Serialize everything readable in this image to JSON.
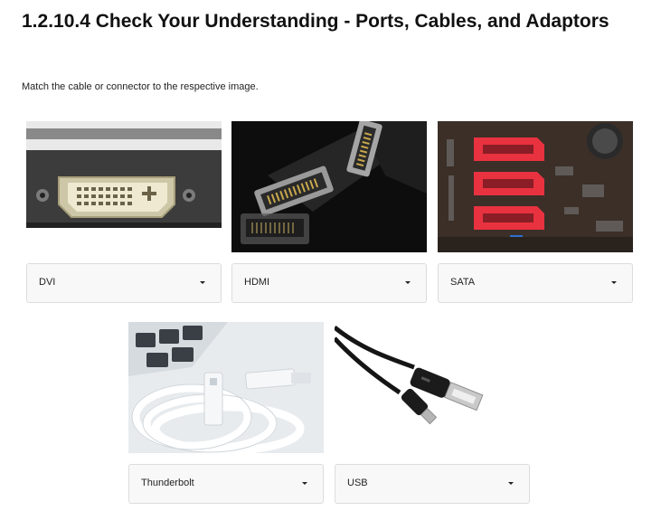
{
  "page": {
    "title": "1.2.10.4 Check Your Understanding - Ports, Cables, and Adaptors",
    "instructions": "Match the cable or connector to the respective image."
  },
  "items": [
    {
      "image": "dvi-port-photo",
      "selected": "DVI"
    },
    {
      "image": "hdmi-cable-photo",
      "selected": "HDMI"
    },
    {
      "image": "sata-ports-photo",
      "selected": "SATA"
    },
    {
      "image": "thunderbolt-cable-photo",
      "selected": "Thunderbolt"
    },
    {
      "image": "usb-cable-photo",
      "selected": "USB"
    }
  ],
  "dropdown_icon": "chevron-down-icon"
}
